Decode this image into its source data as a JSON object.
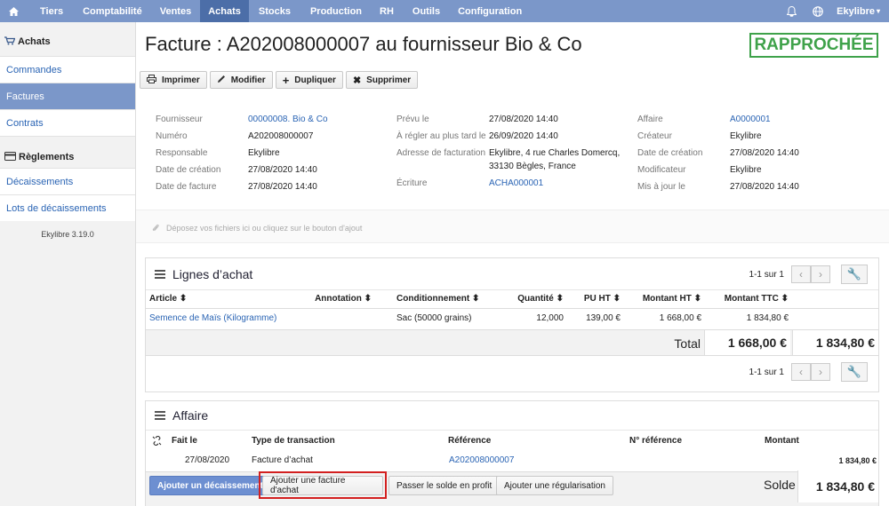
{
  "topnav": {
    "items": [
      "Tiers",
      "Comptabilité",
      "Ventes",
      "Achats",
      "Stocks",
      "Production",
      "RH",
      "Outils",
      "Configuration"
    ],
    "active": "Achats",
    "user": "Ekylibre"
  },
  "sidebar": {
    "achats_title": "Achats",
    "achats_items": [
      "Commandes",
      "Factures",
      "Contrats"
    ],
    "reglements_title": "Règlements",
    "reglements_items": [
      "Décaissements",
      "Lots de décaissements"
    ],
    "version": "Ekylibre 3.19.0"
  },
  "page": {
    "title": "Facture : A202008000007 au fournisseur Bio & Co",
    "status": "RAPPROCHÉE"
  },
  "toolbar": {
    "print": "Imprimer",
    "edit": "Modifier",
    "duplicate": "Dupliquer",
    "delete": "Supprimer"
  },
  "info": {
    "col1": [
      {
        "label": "Fournisseur",
        "value": "00000008. Bio & Co",
        "link": true
      },
      {
        "label": "Numéro",
        "value": "A202008000007"
      },
      {
        "label": "Responsable",
        "value": "Ekylibre"
      },
      {
        "label": "Date de création",
        "value": "27/08/2020 14:40"
      },
      {
        "label": "Date de facture",
        "value": "27/08/2020 14:40"
      }
    ],
    "col2": [
      {
        "label": "Prévu le",
        "value": "27/08/2020 14:40"
      },
      {
        "label": "À régler au plus tard le",
        "value": "26/09/2020 14:40"
      },
      {
        "label": "Adresse de facturation",
        "value": "Ekylibre, 4 rue Charles Domercq,",
        "value2": "33130 Bègles, France"
      },
      {
        "label": "Écriture",
        "value": "ACHA000001",
        "link": true
      }
    ],
    "col3": [
      {
        "label": "Affaire",
        "value": "A0000001",
        "link": true
      },
      {
        "label": "Créateur",
        "value": "Ekylibre"
      },
      {
        "label": "Date de création",
        "value": "27/08/2020 14:40"
      },
      {
        "label": "Modificateur",
        "value": "Ekylibre"
      },
      {
        "label": "Mis à jour le",
        "value": "27/08/2020 14:40"
      }
    ]
  },
  "dropzone": "Déposez vos fichiers ici ou cliquez sur le bouton d'ajout",
  "lines_panel": {
    "title": "Lignes d’achat",
    "pagination": "1-1 sur 1",
    "columns": [
      "Article",
      "Annotation",
      "Conditionnement",
      "Quantité",
      "PU HT",
      "Montant HT",
      "Montant TTC"
    ],
    "rows": [
      {
        "article": "Semence de Maïs (Kilogramme)",
        "annotation": "",
        "conditionnement": "Sac (50000 grains)",
        "quantite": "12,000",
        "pu_ht": "139,00 €",
        "montant_ht": "1 668,00 €",
        "montant_ttc": "1 834,80 €"
      }
    ],
    "total_label": "Total",
    "total_ht": "1 668,00 €",
    "total_ttc": "1 834,80 €"
  },
  "affaire_panel": {
    "title": "Affaire",
    "columns": [
      "Fait le",
      "Type de transaction",
      "Référence",
      "N° référence",
      "Montant"
    ],
    "rows": [
      {
        "date": "27/08/2020",
        "type": "Facture d’achat",
        "reference": "A202008000007",
        "num_ref": "",
        "montant": "1 834,80 €"
      }
    ],
    "buttons": [
      "Ajouter un décaissement",
      "Ajouter une facture d'achat",
      "Passer le solde en profit",
      "Ajouter une régularisation"
    ],
    "solde_label": "Solde",
    "solde_value": "1 834,80 €"
  }
}
